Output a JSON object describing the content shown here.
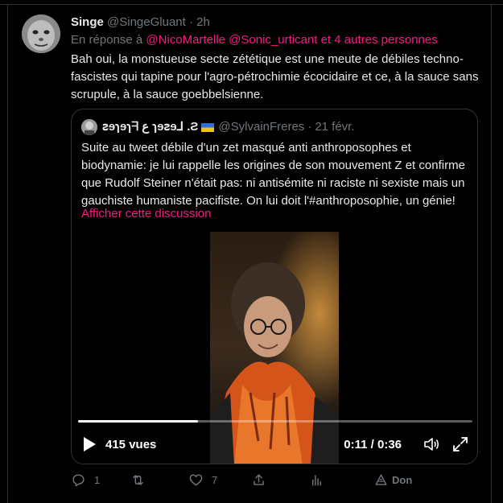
{
  "tweet": {
    "author_name": "Singe",
    "author_handle": "@SingeGluant",
    "time": "2h",
    "reply_prefix": "En réponse à",
    "reply_mention1": "@NicoMartelle",
    "reply_mention2": "@Sonic_urticant",
    "reply_others": "et 4 autres personnes",
    "text": "Bah oui, la monstueuse secte zététique est une meute de débiles techno-fascistes qui tapine pour l'agro-pétrochimie écocidaire et ce, à la sauce sans scrupule, à la sauce goebbelsienne."
  },
  "quote": {
    "author_name": "ꙅɘɿɘɿᖷ ﻉ ɿɘꙅɘ⅃ .Ƨ",
    "author_handle": "@SylvainFreres",
    "date": "21 févr.",
    "text": "Suite au tweet débile d'un zet masqué anti anthroposophes et biodynamie: je lui rappelle les origines de son mouvement Z et confirme que Rudolf Steiner n'était pas: ni antisémite ni raciste ni sexiste mais un gauchiste humaniste pacifiste. On lui doit l'#anthroposophie, un génie!",
    "show_thread": "Afficher cette discussion"
  },
  "video": {
    "views": "415 vues",
    "time": "0:11 / 0:36",
    "progress": 0.305
  },
  "actions": {
    "reply_count": "1",
    "retweet_count": "",
    "like_count": "7",
    "donate_label": "Don"
  },
  "colors": {
    "accent": "#f91880",
    "muted": "#71767b",
    "text": "#e7e9ea",
    "border": "#2f3336"
  }
}
